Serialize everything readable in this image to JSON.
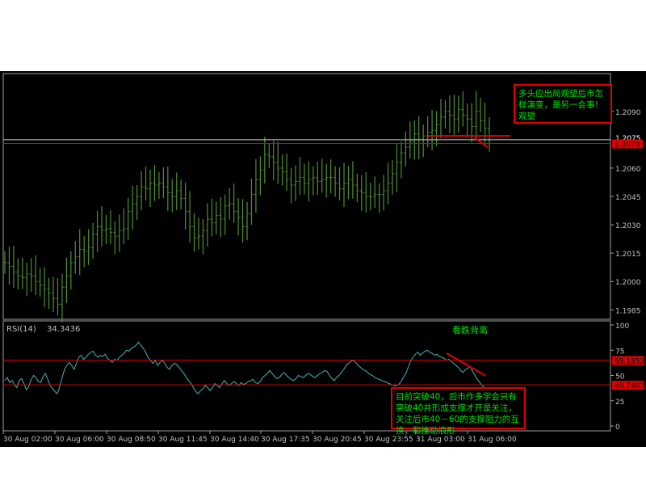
{
  "chart_data": [
    {
      "type": "candlestick",
      "title": "",
      "ylim": [
        1.198,
        1.211
      ],
      "y_ticks": [
        "1.2090",
        "1.2060",
        "1.2045",
        "1.2030",
        "1.2015",
        "1.2000",
        "1.1985"
      ],
      "price_label_upper": "1.2075",
      "price_label_lower": "1.2073",
      "series": [
        {
          "values": [
            1.201,
            1.2008,
            1.2005,
            1.2003,
            1.2002,
            1.2004,
            1.2003,
            1.2,
            1.1998,
            1.1996,
            1.1994,
            1.1991,
            1.1988,
            1.1997,
            1.2003,
            1.201,
            1.2013,
            1.2017,
            1.2016,
            1.2018,
            1.2025,
            1.2029,
            1.2027,
            1.2028,
            1.2026,
            1.2024,
            1.2027,
            1.2028,
            1.2037,
            1.2041,
            1.2045,
            1.205,
            1.2049,
            1.2052,
            1.2051,
            1.2052,
            1.205,
            1.2047,
            1.2045,
            1.2048,
            1.2044,
            1.2037,
            1.2029,
            1.2023,
            1.2024,
            1.2027,
            1.2033,
            1.2031,
            1.2035,
            1.2033,
            1.204,
            1.2041,
            1.2037,
            1.2034,
            1.2029,
            1.2036,
            1.2046,
            1.2054,
            1.2059,
            1.2067,
            1.2066,
            1.2063,
            1.206,
            1.2058,
            1.2054,
            1.2051,
            1.2053,
            1.2055,
            1.2052,
            1.2054,
            1.2055,
            1.2053,
            1.2054,
            1.2055,
            1.2055,
            1.2052,
            1.2049,
            1.2052,
            1.2054,
            1.2051,
            1.2048,
            1.2047,
            1.2045,
            1.2045,
            1.2046,
            1.2046,
            1.2048,
            1.2052,
            1.2057,
            1.2063,
            1.2068,
            1.2071,
            1.2074,
            1.2078,
            1.2073,
            1.2077,
            1.2079,
            1.208,
            1.2083,
            1.2087,
            1.209,
            1.2088,
            1.2086,
            1.2091,
            1.2088,
            1.2086,
            1.2082,
            1.209,
            1.2085,
            1.2081,
            1.2077
          ]
        }
      ]
    },
    {
      "type": "line",
      "title": "RSI(14)",
      "current_value_label": "34.3436",
      "ylim": [
        0,
        100
      ],
      "y_ticks": [
        "100",
        "75",
        "50",
        "25",
        "0"
      ],
      "level_upper": "65.1852",
      "level_lower": "40.7407",
      "series": [
        {
          "values": [
            45,
            48,
            43,
            45,
            41,
            38,
            45,
            47,
            42,
            36,
            39,
            46,
            50,
            48,
            44,
            43,
            49,
            52,
            46,
            40,
            37,
            34,
            32,
            39,
            48,
            56,
            60,
            63,
            60,
            56,
            62,
            68,
            70,
            66,
            68,
            71,
            73,
            74,
            70,
            68,
            70,
            69,
            71,
            67,
            65,
            63,
            66,
            65,
            68,
            70,
            72,
            75,
            74,
            77,
            78,
            80,
            83,
            80,
            77,
            73,
            68,
            65,
            62,
            65,
            60,
            63,
            65,
            62,
            58,
            56,
            60,
            62,
            61,
            58,
            55,
            52,
            48,
            45,
            42,
            38,
            34,
            32,
            35,
            37,
            40,
            38,
            35,
            38,
            42,
            40,
            38,
            42,
            45,
            42,
            40,
            42,
            44,
            42,
            40,
            43,
            41,
            42,
            44,
            45,
            46,
            43,
            42,
            44,
            48,
            50,
            52,
            55,
            52,
            49,
            47,
            48,
            51,
            53,
            50,
            48,
            46,
            45,
            47,
            50,
            49,
            48,
            50,
            52,
            51,
            49,
            48,
            50,
            52,
            53,
            55,
            54,
            50,
            47,
            45,
            48,
            50,
            53,
            56,
            60,
            62,
            64,
            65,
            63,
            60,
            58,
            56,
            55,
            53,
            51,
            50,
            48,
            47,
            46,
            45,
            44,
            43,
            42,
            41,
            40,
            40,
            41,
            44,
            48,
            52,
            58,
            64,
            68,
            71,
            73,
            70,
            72,
            74,
            75,
            73,
            72,
            70,
            71,
            69,
            68,
            67,
            65,
            66,
            64,
            62,
            60,
            58,
            55,
            53,
            56,
            57,
            59,
            54,
            50,
            46,
            43,
            40,
            38,
            36,
            34
          ]
        }
      ]
    }
  ],
  "xaxis": {
    "labels": [
      "30 Aug 02:00",
      "30 Aug 06:00",
      "30 Aug 08:50",
      "30 Aug 11:45",
      "30 Aug 14:40",
      "30 Aug 17:35",
      "30 Aug 20:45",
      "30 Aug 23:55",
      "31 Aug 03:00",
      "31 Aug 06:00"
    ]
  },
  "annotations": {
    "price_note": "多头应出局观望后市怎样演变，是另一会事！观望",
    "divergence_label": "看跌背离",
    "rsi_note": "目前突破40，后市作多学会只有突破40并形成支撑才开是关注，关注后市40－60的支撑阻力的互换，和推动浪形"
  },
  "colors": {
    "background": "#000000",
    "candles": "#4f8f2f",
    "rsi_line": "#3fb8b8",
    "level_lines": "#e00000",
    "annotation_text": "#00e000",
    "axis_text": "#c0c0c0",
    "panel_border": "#a0a0a0"
  }
}
